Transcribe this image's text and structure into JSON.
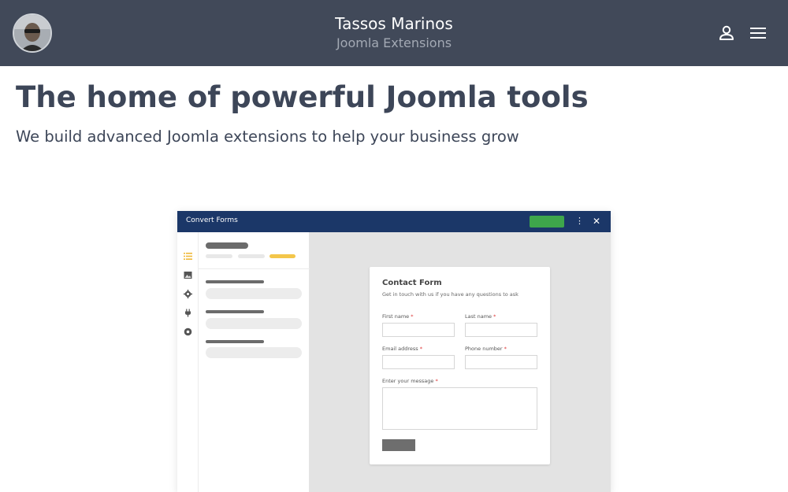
{
  "header": {
    "name": "Tassos Marinos",
    "subtitle": "Joomla Extensions",
    "avatar_icon": "profile-photo",
    "user_icon": "user-icon",
    "menu_icon": "hamburger-menu-icon",
    "background_color": "#414959"
  },
  "hero": {
    "title": "The home of powerful Joomla tools",
    "subtitle": "We build advanced Joomla extensions to help your business grow"
  },
  "mockup": {
    "app_title": "Convert Forms",
    "dots_icon": "⋮",
    "close_icon": "✕",
    "accent_bar_color": "#1b3768",
    "save_button_color": "#3ea64b",
    "rail_icons": [
      "list-icon",
      "image-icon",
      "gear-icon",
      "plug-icon",
      "circle-settings-icon"
    ],
    "form": {
      "title": "Contact Form",
      "description": "Get in touch with us if you have any questions to ask",
      "required_mark": "*",
      "fields": {
        "first_name": "First name",
        "last_name": "Last name",
        "email": "Email address",
        "phone": "Phone number",
        "message": "Enter your message"
      }
    }
  }
}
